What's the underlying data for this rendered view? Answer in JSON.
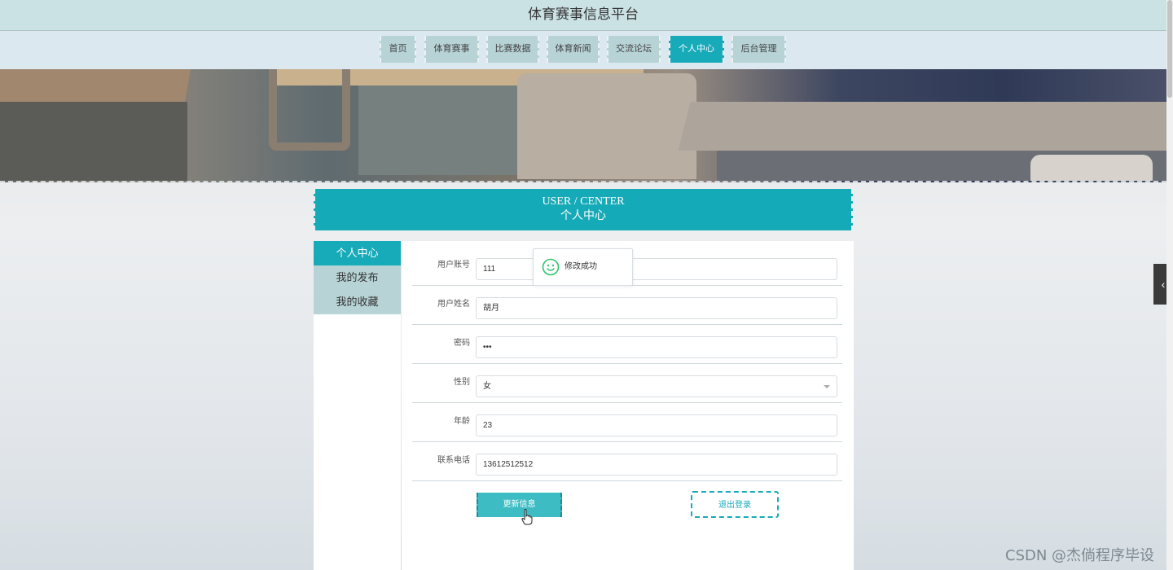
{
  "app": {
    "title": "体育赛事信息平台"
  },
  "nav": {
    "items": [
      {
        "label": "首页"
      },
      {
        "label": "体育赛事"
      },
      {
        "label": "比赛数据"
      },
      {
        "label": "体育新闻"
      },
      {
        "label": "交流论坛"
      },
      {
        "label": "个人中心",
        "active": true
      },
      {
        "label": "后台管理"
      }
    ]
  },
  "center_header": {
    "en": "USER / CENTER",
    "zh": "个人中心"
  },
  "left_menu": {
    "items": [
      {
        "label": "个人中心",
        "active": true
      },
      {
        "label": "我的发布"
      },
      {
        "label": "我的收藏"
      }
    ]
  },
  "form": {
    "fields": [
      {
        "label": "用户账号",
        "value": "111"
      },
      {
        "label": "用户姓名",
        "value": "胡月"
      },
      {
        "label": "密码",
        "value": "•••"
      },
      {
        "label": "性别",
        "value": "女",
        "type": "select"
      },
      {
        "label": "年龄",
        "value": "23"
      },
      {
        "label": "联系电话",
        "value": "13612512512"
      }
    ],
    "update_button": "更新信息",
    "logout_button": "退出登录"
  },
  "toast": {
    "message": "修改成功",
    "icon": "smile-icon"
  },
  "side_toggle": {
    "icon": "chevron-left-icon",
    "glyph": "‹"
  },
  "watermark": "CSDN @杰倘程序毕设",
  "colors": {
    "accent": "#17aab9",
    "nav_bg": "#dce8ef",
    "title_bg": "#cbe2e5",
    "nav_item": "#b7d3d6",
    "toast_icon": "#2dc26b"
  }
}
